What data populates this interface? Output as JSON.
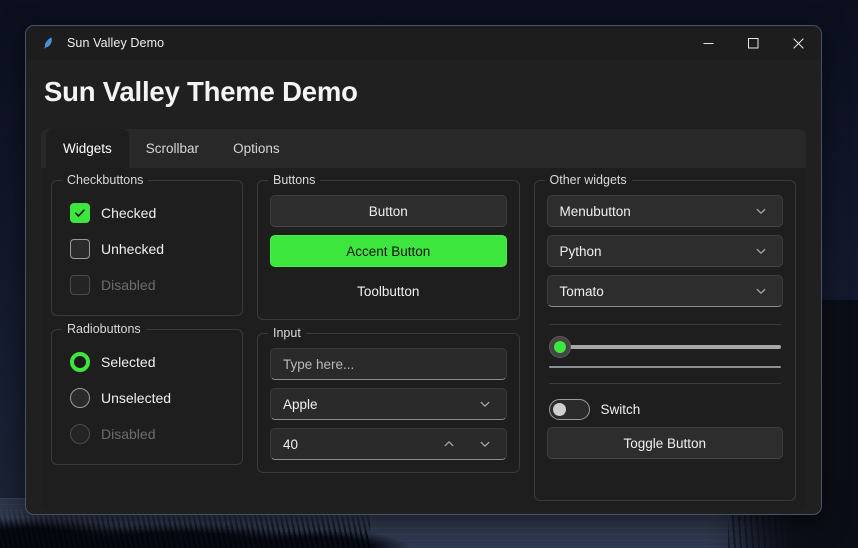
{
  "window": {
    "titlebar": {
      "icon": "feather-icon",
      "title": "Sun Valley Demo",
      "minimize_label": "—",
      "maximize_label": "□",
      "close_label": "✕"
    },
    "page_title": "Sun Valley Theme Demo"
  },
  "tabs": [
    {
      "label": "Widgets",
      "active": true
    },
    {
      "label": "Scrollbar",
      "active": false
    },
    {
      "label": "Options",
      "active": false
    }
  ],
  "checkbuttons": {
    "title": "Checkbuttons",
    "items": [
      {
        "label": "Checked",
        "state": "checked"
      },
      {
        "label": "Unhecked",
        "state": "unchecked"
      },
      {
        "label": "Disabled",
        "state": "disabled"
      }
    ]
  },
  "radiobuttons": {
    "title": "Radiobuttons",
    "items": [
      {
        "label": "Selected",
        "state": "selected"
      },
      {
        "label": "Unselected",
        "state": "unselected"
      },
      {
        "label": "Disabled",
        "state": "disabled"
      }
    ]
  },
  "buttons": {
    "title": "Buttons",
    "normal_label": "Button",
    "accent_label": "Accent Button",
    "tool_label": "Toolbutton"
  },
  "input": {
    "title": "Input",
    "entry_placeholder": "Type here...",
    "entry_value": "",
    "combobox_value": "Apple",
    "combobox_icon": "chevron-down-icon",
    "spinbox_value": "40",
    "spinbox_up_icon": "chevron-up-icon",
    "spinbox_down_icon": "chevron-down-icon"
  },
  "other_widgets": {
    "title": "Other widgets",
    "menubutton_label": "Menubutton",
    "menubutton_icon": "chevron-down-icon",
    "combobox_value": "Python",
    "combobox_icon": "chevron-down-icon",
    "optionmenu_value": "Tomato",
    "optionmenu_icon": "chevron-down-icon",
    "scale_value": 0,
    "progress_value": 0,
    "switch_label": "Switch",
    "switch_state": "off",
    "toggle_button_label": "Toggle Button"
  },
  "colors": {
    "accent": "#3ce63c",
    "window_bg": "#202020",
    "page_bg": "#1e1e1e",
    "tabstrip_bg": "#282828",
    "text": "#f0f0f0",
    "text_disabled": "#6d6d6d",
    "border": "#3a3a3a"
  }
}
